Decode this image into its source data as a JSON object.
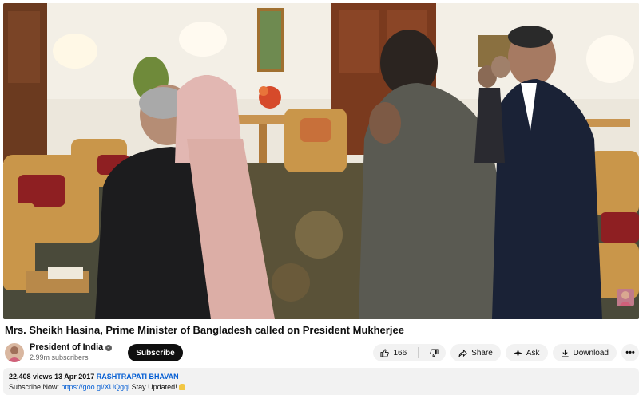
{
  "video": {
    "title": "Mrs. Sheikh Hasina, Prime Minister of Bangladesh called on President Mukherjee"
  },
  "channel": {
    "name": "President of India",
    "subscribers": "2.99m subscribers",
    "subscribe_label": "Subscribe"
  },
  "actions": {
    "like_count": "166",
    "share_label": "Share",
    "ask_label": "Ask",
    "download_label": "Download",
    "more_label": "•••"
  },
  "description": {
    "views": "22,408 views",
    "date": "13 Apr 2017",
    "hashtag": "RASHTRAPATI BHAVAN",
    "line2_prefix": "Subscribe Now:",
    "link": "https://goo.gl/XUQgqi",
    "line2_suffix": "Stay Updated!"
  },
  "colors": {
    "subscribe_bg": "#0f0f0f",
    "link": "#065fd4",
    "pill_bg": "#f2f2f2"
  },
  "icons": [
    "verified-icon",
    "thumbs-up-icon",
    "thumbs-down-icon",
    "share-icon",
    "ask-icon",
    "download-icon",
    "more-icon",
    "bell-emoji-icon"
  ]
}
